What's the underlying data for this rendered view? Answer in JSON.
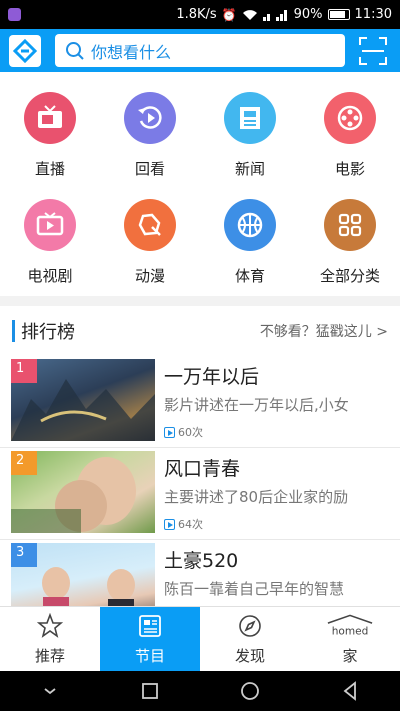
{
  "status_bar": {
    "speed": "1.8K/s",
    "battery": "90%",
    "time": "11:30"
  },
  "header": {
    "search_placeholder": "你想看什么"
  },
  "categories": [
    {
      "label": "直播",
      "color": "#e9526e",
      "icon": "tv-icon"
    },
    {
      "label": "回看",
      "color": "#7b7be6",
      "icon": "replay-icon"
    },
    {
      "label": "新闻",
      "color": "#42b7ef",
      "icon": "news-icon"
    },
    {
      "label": "电影",
      "color": "#f2616c",
      "icon": "film-reel-icon"
    },
    {
      "label": "电视剧",
      "color": "#f37aa8",
      "icon": "tv-play-icon"
    },
    {
      "label": "动漫",
      "color": "#f1703e",
      "icon": "cartoon-icon"
    },
    {
      "label": "体育",
      "color": "#3d8fe6",
      "icon": "basketball-icon"
    },
    {
      "label": "全部分类",
      "color": "#c77a3a",
      "icon": "grid-icon"
    }
  ],
  "ranking": {
    "title": "排行榜",
    "more": "不够看？猛戳这儿 >",
    "items": [
      {
        "rank": "1",
        "badge_color": "#e9526e",
        "title": "一万年以后",
        "desc": "影片讲述在一万年以后,小女",
        "plays": "60次"
      },
      {
        "rank": "2",
        "badge_color": "#f39a2b",
        "title": "风口青春",
        "desc": "主要讲述了80后企业家的励",
        "plays": "64次"
      },
      {
        "rank": "3",
        "badge_color": "#3d8fe6",
        "title": "土豪520",
        "desc": "陈百一靠着自己早年的智慧",
        "plays": ""
      }
    ]
  },
  "tabs": [
    {
      "label": "推荐",
      "icon": "star-icon",
      "active": false
    },
    {
      "label": "节目",
      "icon": "program-list-icon",
      "active": true
    },
    {
      "label": "发现",
      "icon": "compass-icon",
      "active": false
    },
    {
      "label": "家",
      "icon": "homed-icon",
      "active": false
    }
  ]
}
